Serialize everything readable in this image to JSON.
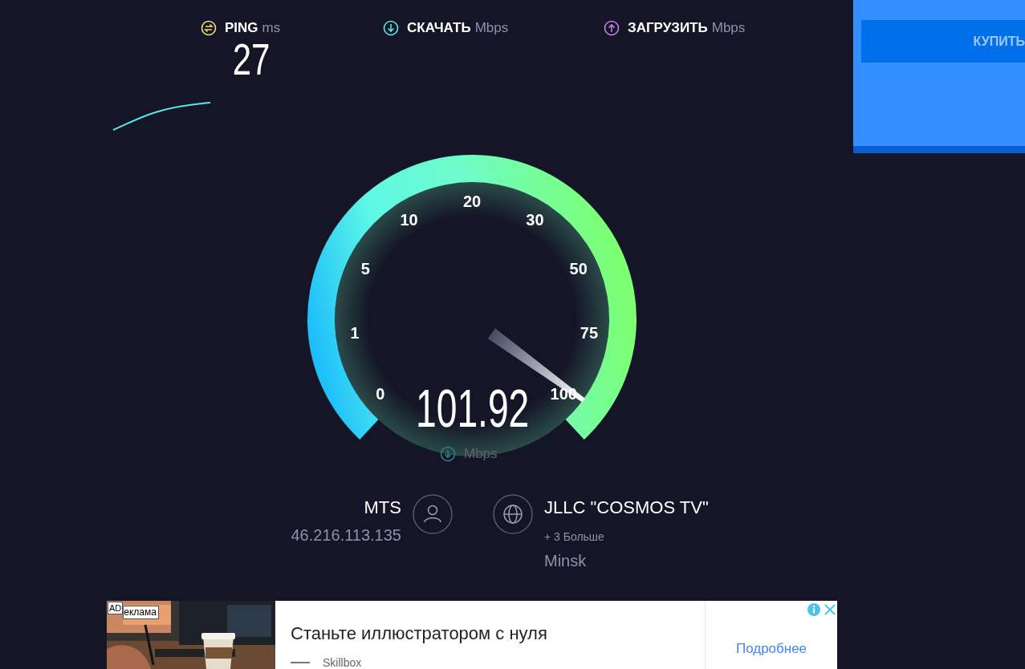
{
  "metrics": [
    {
      "kind": "ping",
      "label": "PING",
      "unit": "ms",
      "value": "27"
    },
    {
      "kind": "download",
      "label": "СКАЧАТЬ",
      "unit": "Mbps"
    },
    {
      "kind": "upload",
      "label": "ЗАГРУЗИТЬ",
      "unit": "Mbps"
    }
  ],
  "side_ad": {
    "button": "КУПИТЬ"
  },
  "gauge": {
    "ticks": [
      "0",
      "1",
      "5",
      "10",
      "20",
      "30",
      "50",
      "75",
      "100"
    ],
    "value": "101.92",
    "unit": "Mbps"
  },
  "isp": {
    "name": "MTS",
    "ip": "46.216.113.135"
  },
  "server": {
    "name": "JLLC \"COSMOS TV\"",
    "more": "+ 3 Больше",
    "city": "Minsk"
  },
  "ad": {
    "badge": "AD",
    "label": "еклама",
    "headline": "Станьте иллюстратором с нуля",
    "brand": "Skillbox",
    "cta": "Подробнее"
  }
}
